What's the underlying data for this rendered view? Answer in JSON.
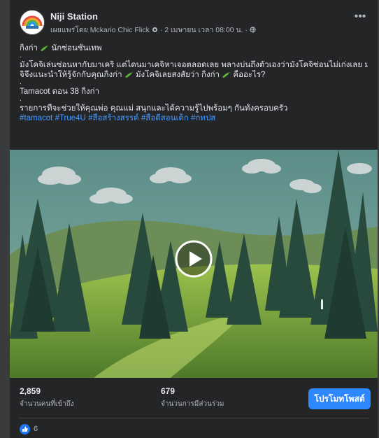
{
  "post": {
    "page_name": "Niji Station",
    "meta": "เผยแพร่โดย Mckario Chic Flick",
    "meta_date": " · 2 เมษายน เวลา 08:00 น. · ",
    "more_icon": "ellipsis-icon",
    "lines": [
      "กิ้งก่า",
      "นักซ่อนชั้นเทพ",
      "มังโคจิเล่นซ่อนหากับมาเคริ แต่ไดนมาเคจิหาเจอตลอดเลย พลางบ่นถึงตัวเองว่ามังโคจิซ่อนไม่เก่งเลย มาเค",
      "จิจึงแนะนำให้รู้จักกับคุณกิ้งก่า",
      "มังโคจิเลยสงสัยว่า กิ้งก่า",
      "คืออะไร?",
      "Tamacot ตอน 38 กิ้งก่า",
      "รายการที่จะช่วยให้คุณพ่อ คุณแม่ สนุกและได้ความรู้ไปพร้อมๆ กันทั้งครอบครัว"
    ],
    "hashtags": [
      "#tamacot",
      "#True4U",
      "#สื่อสร้างสรรค์",
      "#สื่อดีสอนเด็ก",
      "#กทปส"
    ],
    "dot": "."
  },
  "stats": {
    "reach_value": "2,859",
    "reach_label": "จำนวนคนที่เข้าถึง",
    "engagement_value": "679",
    "engagement_label": "จำนวนการมีส่วนร่วม",
    "boost_label": "โปรโมทโพสต์"
  },
  "reactions": {
    "like_count": "6"
  },
  "colors": {
    "accent": "#2d88ff",
    "card_bg": "#242526",
    "hashtag": "#4599ff"
  }
}
